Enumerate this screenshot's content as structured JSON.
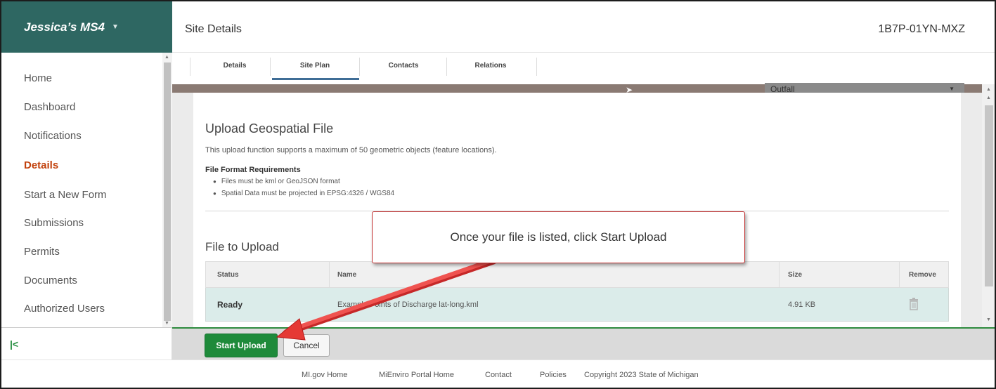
{
  "sidebar": {
    "app_title": "Jessica’s MS4",
    "items": [
      {
        "label": "Home",
        "active": false
      },
      {
        "label": "Dashboard",
        "active": false
      },
      {
        "label": "Notifications",
        "active": false
      },
      {
        "label": "Details",
        "active": true
      },
      {
        "label": "Start a New Form",
        "active": false
      },
      {
        "label": "Submissions",
        "active": false
      },
      {
        "label": "Permits",
        "active": false
      },
      {
        "label": "Documents",
        "active": false
      },
      {
        "label": "Authorized Users",
        "active": false
      }
    ]
  },
  "header": {
    "title": "Site Details",
    "site_id": "1B7P-01YN-MXZ"
  },
  "tabs": [
    {
      "label": "Details"
    },
    {
      "label": "Site Plan",
      "selected": true
    },
    {
      "label": "Contacts"
    },
    {
      "label": "Relations"
    }
  ],
  "map": {
    "layer_select_value": "Outfall"
  },
  "upload": {
    "heading": "Upload Geospatial File",
    "description": "This upload function supports a maximum of 50 geometric objects (feature locations).",
    "requirements_title": "File Format Requirements",
    "requirements": [
      "Files must be kml or GeoJSON format",
      "Spatial Data must be projected in EPSG:4326 / WGS84"
    ],
    "file_heading": "File to Upload",
    "table": {
      "columns": [
        "Status",
        "Name",
        "Size",
        "Remove"
      ],
      "rows": [
        {
          "status": "Ready",
          "name": "Example Points of Discharge lat-long.kml",
          "size": "4.91 KB"
        }
      ]
    }
  },
  "actions": {
    "start_upload": "Start Upload",
    "cancel": "Cancel"
  },
  "footer": {
    "links": [
      "MI.gov Home",
      "MiEnviro Portal Home",
      "Contact",
      "Policies"
    ],
    "copyright": "Copyright 2023 State of Michigan"
  },
  "annotation": {
    "callout_text": "Once your file is listed, click Start Upload",
    "arrow_color": "#e53935"
  },
  "colors": {
    "brand": "#2e6762",
    "accent_active": "#c2410c",
    "primary_button": "#1e8a3a",
    "row_highlight": "#dbecea"
  }
}
